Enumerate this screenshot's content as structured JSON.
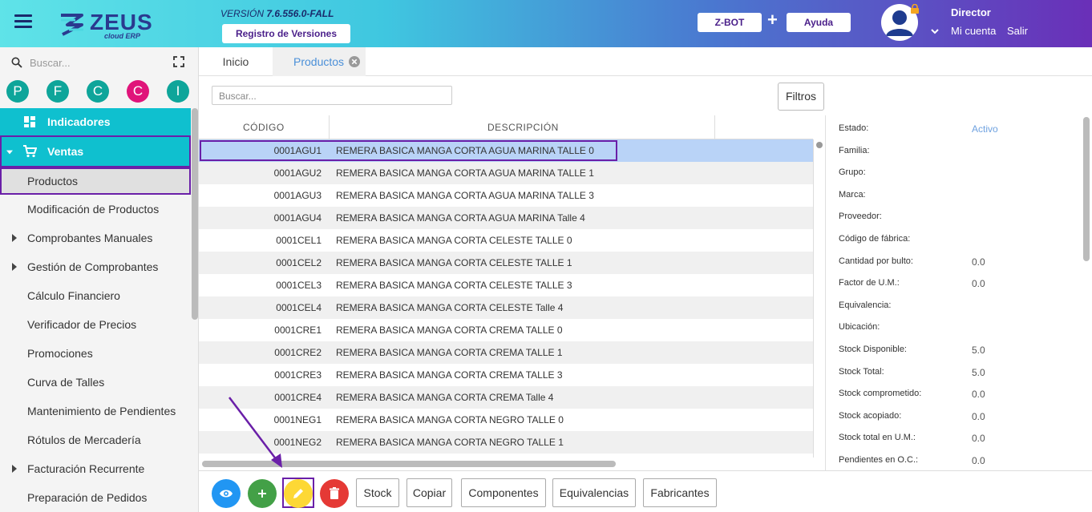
{
  "header": {
    "brand": "ZEUS",
    "brand_sub": "cloud ERP",
    "version_label": "VERSIÓN",
    "version_value": "7.6.556.0-FALL",
    "release_notes_button": "Registro de Versiones",
    "zbot_button": "Z-BOT",
    "plus_symbol": "+",
    "help_button": "Ayuda",
    "user_role": "Director",
    "my_account": "Mi cuenta",
    "logout": "Salir"
  },
  "sidebar": {
    "search_placeholder": "Buscar...",
    "quick_access": [
      {
        "letter": "P",
        "color": "#0ea59a"
      },
      {
        "letter": "F",
        "color": "#0ea59a"
      },
      {
        "letter": "C",
        "color": "#0ea59a"
      },
      {
        "letter": "C",
        "color": "#e0147a"
      },
      {
        "letter": "I",
        "color": "#0ea59a"
      }
    ],
    "items": [
      {
        "label": "Indicadores"
      },
      {
        "label": "Ventas"
      },
      {
        "label": "Productos"
      },
      {
        "label": "Modificación de Productos"
      },
      {
        "label": "Comprobantes Manuales"
      },
      {
        "label": "Gestión de Comprobantes"
      },
      {
        "label": "Cálculo Financiero"
      },
      {
        "label": "Verificador de Precios"
      },
      {
        "label": "Promociones"
      },
      {
        "label": "Curva de Talles"
      },
      {
        "label": "Mantenimiento de Pendientes"
      },
      {
        "label": "Rótulos de Mercadería"
      },
      {
        "label": "Facturación Recurrente"
      },
      {
        "label": "Preparación de Pedidos"
      }
    ]
  },
  "tabs": {
    "home": "Inicio",
    "products": "Productos"
  },
  "content": {
    "search_placeholder": "Buscar...",
    "filters_button": "Filtros",
    "columns": {
      "code": "CÓDIGO",
      "description": "DESCRIPCIÓN"
    },
    "rows": [
      {
        "code": "0001AGU1",
        "description": "REMERA BASICA MANGA CORTA AGUA MARINA TALLE 0"
      },
      {
        "code": "0001AGU2",
        "description": "REMERA BASICA MANGA CORTA AGUA MARINA TALLE 1"
      },
      {
        "code": "0001AGU3",
        "description": "REMERA BASICA MANGA CORTA AGUA MARINA TALLE 3"
      },
      {
        "code": "0001AGU4",
        "description": "REMERA BASICA MANGA CORTA AGUA MARINA Talle 4"
      },
      {
        "code": "0001CEL1",
        "description": "REMERA BASICA MANGA CORTA CELESTE TALLE 0"
      },
      {
        "code": "0001CEL2",
        "description": "REMERA BASICA MANGA CORTA CELESTE TALLE 1"
      },
      {
        "code": "0001CEL3",
        "description": "REMERA BASICA MANGA CORTA CELESTE TALLE 3"
      },
      {
        "code": "0001CEL4",
        "description": "REMERA BASICA MANGA CORTA CELESTE Talle 4"
      },
      {
        "code": "0001CRE1",
        "description": "REMERA BASICA MANGA CORTA CREMA TALLE 0"
      },
      {
        "code": "0001CRE2",
        "description": "REMERA BASICA MANGA CORTA CREMA TALLE 1"
      },
      {
        "code": "0001CRE3",
        "description": "REMERA BASICA MANGA CORTA CREMA TALLE 3"
      },
      {
        "code": "0001CRE4",
        "description": "REMERA BASICA MANGA CORTA CREMA Talle 4"
      },
      {
        "code": "0001NEG1",
        "description": "REMERA BASICA MANGA CORTA NEGRO TALLE 0"
      },
      {
        "code": "0001NEG2",
        "description": "REMERA BASICA MANGA CORTA NEGRO TALLE 1"
      }
    ]
  },
  "detail": {
    "fields": [
      {
        "label": "Estado:",
        "value": "Activo"
      },
      {
        "label": "Familia:",
        "value": ""
      },
      {
        "label": "Grupo:",
        "value": ""
      },
      {
        "label": "Marca:",
        "value": ""
      },
      {
        "label": "Proveedor:",
        "value": ""
      },
      {
        "label": "Código de fábrica:",
        "value": ""
      },
      {
        "label": "Cantidad por bulto:",
        "value": "0.0"
      },
      {
        "label": "Factor de U.M.:",
        "value": "0.0"
      },
      {
        "label": "Equivalencia:",
        "value": ""
      },
      {
        "label": "Ubicación:",
        "value": ""
      },
      {
        "label": "Stock Disponible:",
        "value": "5.0"
      },
      {
        "label": "Stock Total:",
        "value": "5.0"
      },
      {
        "label": "Stock comprometido:",
        "value": "0.0"
      },
      {
        "label": "Stock acopiado:",
        "value": "0.0"
      },
      {
        "label": "Stock total en U.M.:",
        "value": "0.0"
      },
      {
        "label": "Pendientes en O.C.:",
        "value": "0.0"
      }
    ]
  },
  "actions": {
    "stock": "Stock",
    "copy": "Copiar",
    "components": "Componentes",
    "equivalences": "Equivalencias",
    "manufacturers": "Fabricantes"
  },
  "colors": {
    "accent_cyan": "#0fc0cf",
    "highlight_purple": "#6a1fa8",
    "view_blue": "#2196f3",
    "add_green": "#43a047",
    "edit_yellow": "#fdd835",
    "delete_red": "#e53935"
  }
}
